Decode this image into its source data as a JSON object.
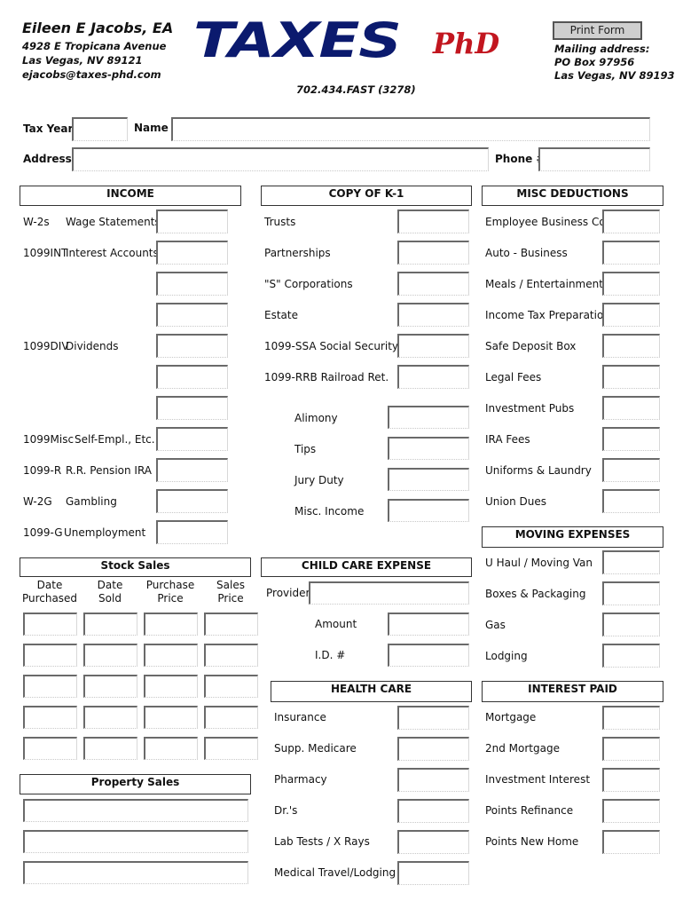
{
  "header": {
    "preparer_name": "Eileen E Jacobs, EA",
    "address_line1": "4928 E Tropicana Avenue",
    "address_line2": "Las Vegas, NV 89121",
    "email": "ejacobs@taxes-phd.com",
    "logo_main": "TAXES",
    "logo_suffix": "PhD",
    "phone": "702.434.FAST (3278)",
    "print_button": "Print Form",
    "mailing_label": "Mailing address:",
    "mailing_line1": "PO Box 97956",
    "mailing_line2": "Las Vegas, NV 89193",
    "brand_color": "#0b1a6e",
    "accent_color": "#c2161f"
  },
  "client": {
    "tax_year_label": "Tax Year",
    "tax_year_value": "",
    "name_label": "Name",
    "name_value": "",
    "address_label": "Address",
    "address_value": "",
    "phone_label": "Phone #",
    "phone_value": ""
  },
  "income": {
    "title": "INCOME",
    "rows": [
      {
        "form": "W-2s",
        "label": "Wage Statements",
        "value": ""
      },
      {
        "form": "1099INT",
        "label": "Interest Accounts",
        "value": ""
      },
      {
        "form": "",
        "label": "",
        "value": ""
      },
      {
        "form": "",
        "label": "",
        "value": ""
      },
      {
        "form": "1099DIV",
        "label": "Dividends",
        "value": ""
      },
      {
        "form": "",
        "label": "",
        "value": ""
      },
      {
        "form": "",
        "label": "",
        "value": ""
      },
      {
        "form": "1099Misc",
        "label": "Self-Empl., Etc.",
        "value": ""
      },
      {
        "form": "1099-R",
        "label": "R.R. Pension IRA",
        "value": ""
      },
      {
        "form": "W-2G",
        "label": "Gambling",
        "value": ""
      },
      {
        "form": "1099-G",
        "label": "Unemployment",
        "value": ""
      }
    ]
  },
  "k1": {
    "title": "COPY OF K-1",
    "rows": [
      {
        "label": "Trusts",
        "value": ""
      },
      {
        "label": "Partnerships",
        "value": ""
      },
      {
        "label": "\"S\" Corporations",
        "value": ""
      },
      {
        "label": "Estate",
        "value": ""
      },
      {
        "label": "1099-SSA Social Security",
        "value": ""
      },
      {
        "label": "1099-RRB Railroad Ret.",
        "value": ""
      }
    ],
    "other_rows": [
      {
        "label": "Alimony",
        "value": ""
      },
      {
        "label": "Tips",
        "value": ""
      },
      {
        "label": "Jury Duty",
        "value": ""
      },
      {
        "label": "Misc. Income",
        "value": ""
      }
    ]
  },
  "misc_deductions": {
    "title": "MISC DEDUCTIONS",
    "rows": [
      {
        "label": "Employee Business Costs",
        "value": ""
      },
      {
        "label": "Auto - Business",
        "value": ""
      },
      {
        "label": "Meals / Entertainment",
        "value": ""
      },
      {
        "label": "Income Tax Preparation",
        "value": ""
      },
      {
        "label": "Safe Deposit Box",
        "value": ""
      },
      {
        "label": "Legal Fees",
        "value": ""
      },
      {
        "label": "Investment Pubs",
        "value": ""
      },
      {
        "label": "IRA Fees",
        "value": ""
      },
      {
        "label": "Uniforms & Laundry",
        "value": ""
      },
      {
        "label": "Union Dues",
        "value": ""
      }
    ]
  },
  "moving_expenses": {
    "title": "MOVING EXPENSES",
    "rows": [
      {
        "label": "U Haul / Moving Van",
        "value": ""
      },
      {
        "label": "Boxes & Packaging",
        "value": ""
      },
      {
        "label": "Gas",
        "value": ""
      },
      {
        "label": "Lodging",
        "value": ""
      }
    ]
  },
  "stock_sales": {
    "title": "Stock Sales",
    "columns": [
      {
        "line1": "Date",
        "line2": "Purchased"
      },
      {
        "line1": "Date",
        "line2": "Sold"
      },
      {
        "line1": "Purchase",
        "line2": "Price"
      },
      {
        "line1": "Sales",
        "line2": "Price"
      }
    ],
    "rows": [
      [
        "",
        "",
        "",
        ""
      ],
      [
        "",
        "",
        "",
        ""
      ],
      [
        "",
        "",
        "",
        ""
      ],
      [
        "",
        "",
        "",
        ""
      ],
      [
        "",
        "",
        "",
        ""
      ]
    ]
  },
  "child_care": {
    "title": "CHILD CARE EXPENSE",
    "provider_label": "Provider",
    "provider_value": "",
    "amount_label": "Amount",
    "amount_value": "",
    "id_label": "I.D. #",
    "id_value": ""
  },
  "health_care": {
    "title": "HEALTH CARE",
    "rows": [
      {
        "label": "Insurance",
        "value": ""
      },
      {
        "label": "Supp. Medicare",
        "value": ""
      },
      {
        "label": "Pharmacy",
        "value": ""
      },
      {
        "label": "Dr.'s",
        "value": ""
      },
      {
        "label": "Lab Tests / X Rays",
        "value": ""
      },
      {
        "label": "Medical Travel/Lodging",
        "value": ""
      }
    ]
  },
  "interest_paid": {
    "title": "INTEREST PAID",
    "rows": [
      {
        "label": "Mortgage",
        "value": ""
      },
      {
        "label": "2nd Mortgage",
        "value": ""
      },
      {
        "label": "Investment Interest",
        "value": ""
      },
      {
        "label": "Points Refinance",
        "value": ""
      },
      {
        "label": "Points New Home",
        "value": ""
      }
    ]
  },
  "property_sales": {
    "title": "Property Sales",
    "rows": [
      "",
      "",
      ""
    ]
  }
}
